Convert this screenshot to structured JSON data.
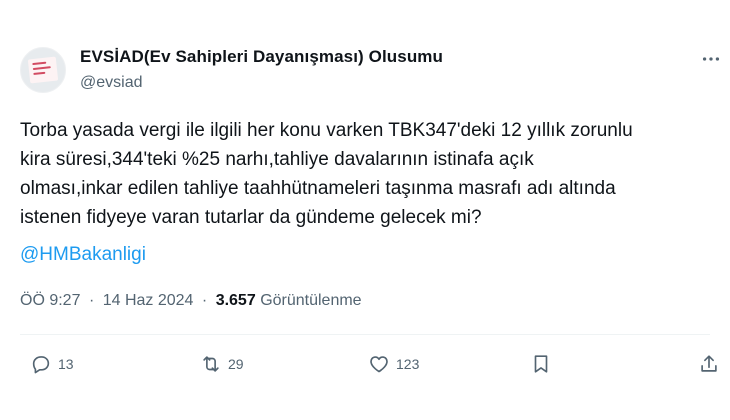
{
  "author": {
    "name": "EVSİAD(Ev Sahipleri Dayanışması) Olusumu",
    "handle": "@evsiad",
    "avatar_icon": "profile-avatar"
  },
  "tweet": {
    "text": "Torba yasada vergi ile ilgili her konu varken TBK347'deki 12 yıllık zorunlu\nkira süresi,344'teki %25 narhı,tahliye davalarının istinafa açık\nolması,inkar edilen tahliye taahhütnameleri taşınma masrafı adı altında\nistenen fidyeye varan tutarlar da gündeme gelecek mi?",
    "mention": "@HMBakanligi"
  },
  "meta": {
    "time": "ÖÖ 9:27",
    "separator": "·",
    "date": "14 Haz 2024",
    "views_count": "3.657",
    "views_label": "Görüntülenme"
  },
  "actions": {
    "replies": "13",
    "retweets": "29",
    "likes": "123"
  },
  "colors": {
    "text": "#0f1419",
    "secondary": "#536471",
    "link": "#1d9bf0",
    "divider": "#eff3f4"
  }
}
